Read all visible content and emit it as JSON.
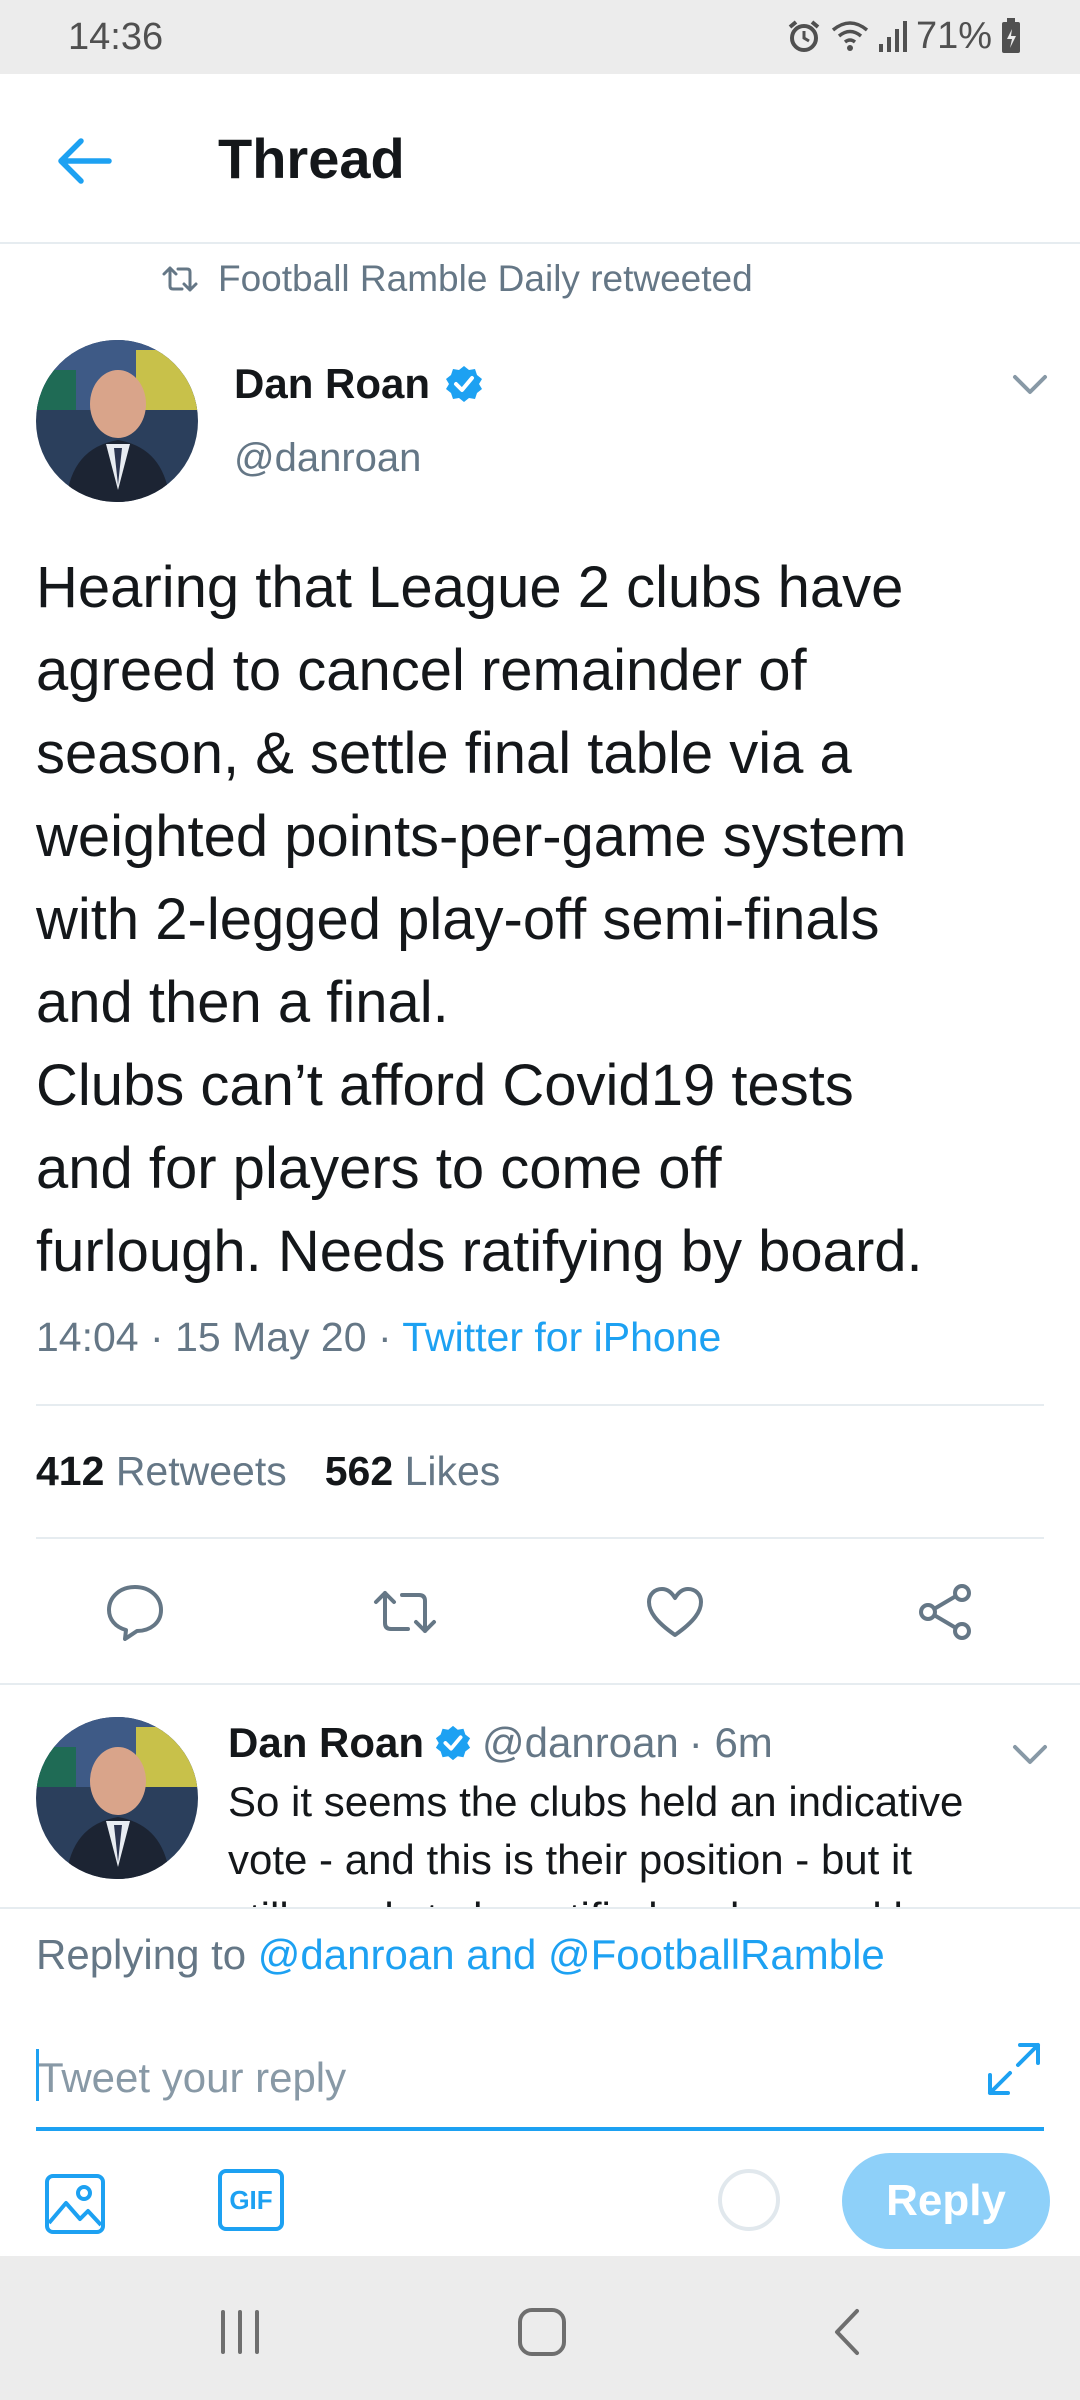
{
  "status_bar": {
    "time": "14:36",
    "battery": "71%",
    "icons": [
      "alarm-icon",
      "wifi-icon",
      "signal-icon",
      "battery-icon"
    ]
  },
  "header": {
    "title": "Thread",
    "back_icon": "arrow-left-icon"
  },
  "retweet_context": {
    "text": "Football Ramble Daily retweeted",
    "icon": "retweet-icon"
  },
  "main_tweet": {
    "author_name": "Dan Roan",
    "handle": "@danroan",
    "verified": true,
    "text_lines": [
      "Hearing that League 2 clubs have",
      "agreed to cancel remainder of",
      "season, & settle final table via a",
      "weighted points-per-game system",
      "with 2-legged play-off semi-finals",
      "and then a final.",
      "Clubs can’t afford Covid19 tests",
      "and for players to come off",
      "furlough. Needs ratifying by board."
    ],
    "time": "14:04",
    "date": "15 May 20",
    "separator": "·",
    "source": "Twitter for iPhone",
    "retweets_count": "412",
    "retweets_label": "Retweets",
    "likes_count": "562",
    "likes_label": "Likes",
    "actions": [
      "reply-icon",
      "retweet-icon",
      "like-icon",
      "share-icon"
    ]
  },
  "reply_tweet": {
    "author_name": "Dan Roan",
    "handle": "@danroan",
    "age": "· 6m",
    "verified": true,
    "text_lines": [
      "So it seems the clubs held an indicative",
      "vote - and this is their position - but it",
      "still needs to be ratified and agreed by"
    ]
  },
  "composer": {
    "replying_prefix": "Replying to",
    "replying_mentions": "@danroan and @FootballRamble",
    "placeholder": "Tweet your reply",
    "gif_label": "GIF",
    "reply_button": "Reply"
  },
  "colors": {
    "accent": "#1da1f2",
    "reply_button_disabled": "#8ed0f9",
    "secondary_text": "#657786",
    "primary_text": "#14171a"
  }
}
